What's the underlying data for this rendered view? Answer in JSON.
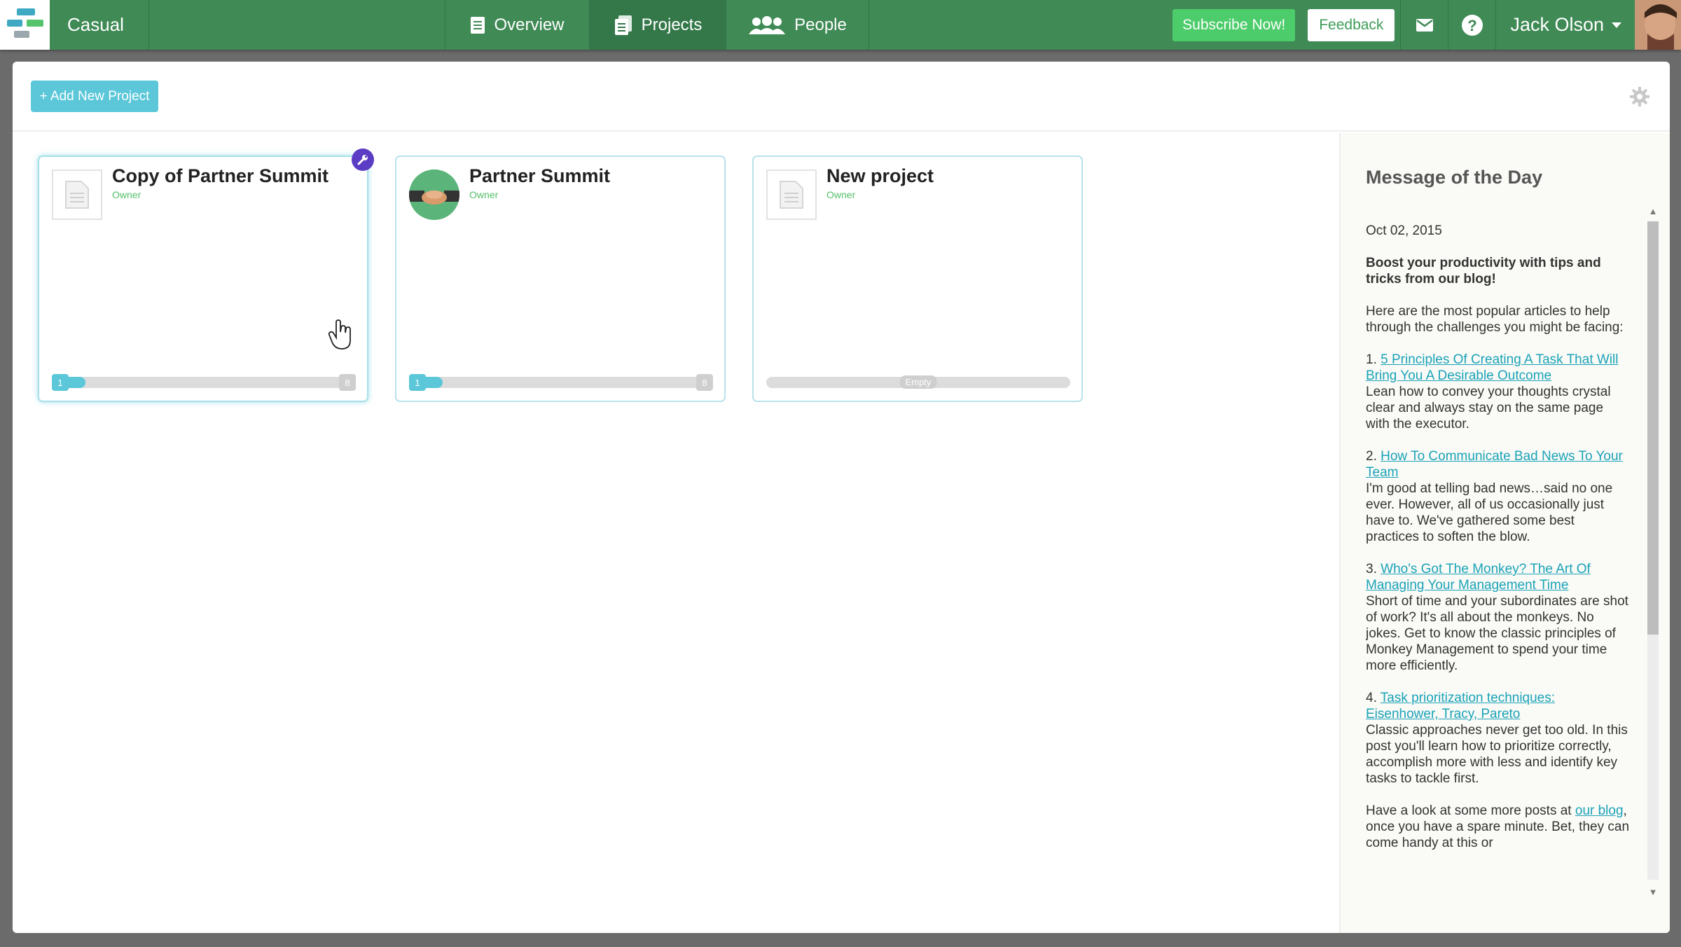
{
  "app": {
    "brand": "Casual",
    "nav": [
      {
        "label": "Overview",
        "icon": "document-icon"
      },
      {
        "label": "Projects",
        "icon": "projects-icon",
        "active": true
      },
      {
        "label": "People",
        "icon": "people-icon"
      }
    ],
    "subscribe_label": "Subscribe Now!",
    "feedback_label": "Feedback",
    "user_name": "Jack Olson"
  },
  "toolbar": {
    "add_project_label": "+ Add New Project"
  },
  "projects": [
    {
      "title": "Copy of Partner Summit",
      "role": "Owner",
      "progress_start": "1",
      "progress_end": "8",
      "progress": 0.05,
      "selected": true
    },
    {
      "title": "Partner Summit",
      "role": "Owner",
      "progress_start": "1",
      "progress_end": "8",
      "progress": 0.05
    },
    {
      "title": "New project",
      "role": "Owner",
      "progress_label": "Empty",
      "progress": 0
    }
  ],
  "motd": {
    "title": "Message of the Day",
    "date": "Oct 02, 2015",
    "headline": "Boost your productivity with tips and tricks from our blog!",
    "intro": "Here are the most popular articles to help through the challenges you might be facing:",
    "articles": [
      {
        "num": "1.",
        "link": "5 Principles Of Creating A Task That Will Bring You A Desirable Outcome",
        "text": "Lean how to convey your thoughts crystal clear and always stay on the same page with the executor."
      },
      {
        "num": "2.",
        "link": "How To Communicate Bad News To Your Team",
        "text": "I'm good at telling bad news…said no one ever. However, all of us occasionally just have to. We've gathered some best practices to soften the blow."
      },
      {
        "num": "3.",
        "link": "Who's Got The Monkey? The Art Of Managing Your Management Time",
        "text": "Short of time and your subordinates are shot of work? It's all about the monkeys. No jokes. Get to know the classic principles of Monkey Management to spend your time more efficiently."
      },
      {
        "num": "4.",
        "link": "Task prioritization techniques: Eisenhower, Tracy, Pareto",
        "text": "Classic approaches never get too old. In this post you'll learn how to prioritize correctly, accomplish more with less and identify key tasks to tackle first."
      }
    ],
    "outro_pre": "Have a look at some more posts at",
    "outro_link": "our blog",
    "outro_post": ", once you have a spare minute. Bet, they can come handy at this or"
  },
  "colors": {
    "topbar": "#3f8a55",
    "accent": "#5bc7d9",
    "subscribe": "#4ccc6a",
    "link": "#1aa3b8"
  }
}
